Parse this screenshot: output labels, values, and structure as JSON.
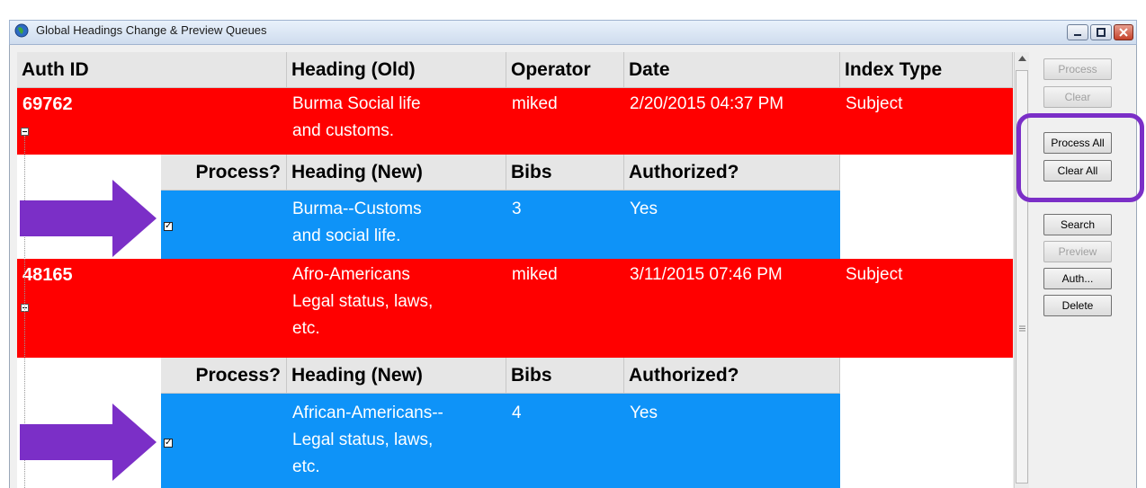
{
  "window": {
    "title": "Global Headings Change &  Preview Queues"
  },
  "grid": {
    "header": {
      "auth_id": "Auth ID",
      "heading_old": "Heading (Old)",
      "operator": "Operator",
      "date": "Date",
      "index_type": "Index Type"
    },
    "sub_header": {
      "process": "Process?",
      "heading_new": "Heading (New)",
      "bibs": "Bibs",
      "authorized": "Authorized?"
    },
    "rows": [
      {
        "auth_id": "69762",
        "heading_old": [
          "Burma Social life",
          "and customs."
        ],
        "operator": "miked",
        "date": "2/20/2015 04:37 PM",
        "index_type": "Subject",
        "child": {
          "process_checked": true,
          "heading_new": [
            "Burma--Customs",
            "and social life."
          ],
          "bibs": "3",
          "authorized": "Yes"
        }
      },
      {
        "auth_id": "48165",
        "heading_old": [
          "Afro-Americans",
          "Legal status, laws,",
          "etc."
        ],
        "operator": "miked",
        "date": "3/11/2015 07:46 PM",
        "index_type": "Subject",
        "child": {
          "process_checked": true,
          "heading_new": [
            "African-Americans--",
            "Legal status, laws,",
            "etc."
          ],
          "bibs": "4",
          "authorized": "Yes"
        }
      }
    ]
  },
  "buttons": {
    "process": "Process",
    "clear": "Clear",
    "process_all": "Process All",
    "clear_all": "Clear All",
    "search": "Search",
    "preview": "Preview",
    "auth": "Auth...",
    "delete": "Delete"
  },
  "colors": {
    "parent_row": "#ff0000",
    "child_row": "#0e93f8",
    "annotation": "#7b2fc7"
  }
}
